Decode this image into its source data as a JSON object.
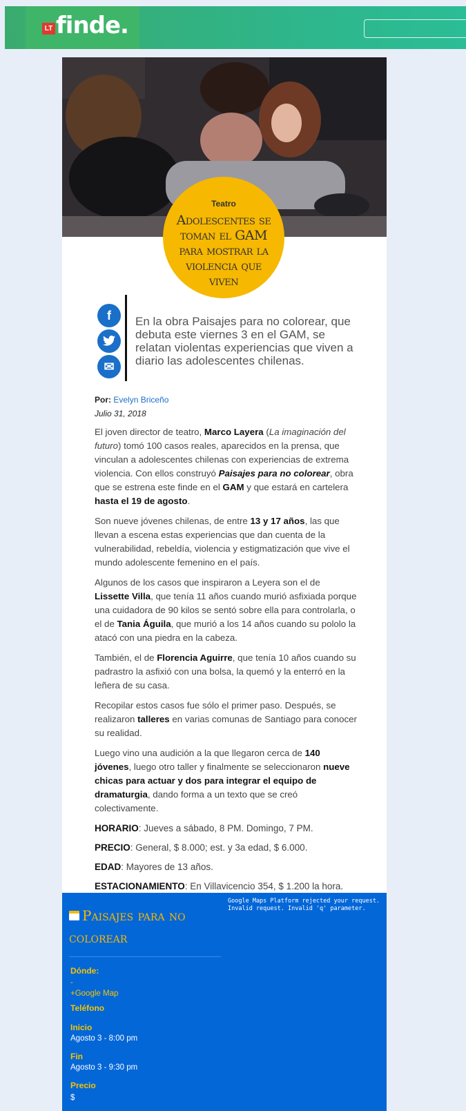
{
  "header": {
    "logo_mark": "LT",
    "logo_text": "finde.",
    "search_placeholder": ""
  },
  "article": {
    "kicker": "Teatro",
    "title": "Adolescentes se toman el GAM para mostrar la violencia que viven",
    "lead": "En la obra Paisajes para no colorear, que debuta este viernes 3 en el GAM, se relatan violentas experiencias que viven a diario las adolescentes chilenas.",
    "byline_label": "Por:",
    "author": "Evelyn Briceño",
    "date": "Julio 31, 2018"
  },
  "share": {
    "facebook": "f",
    "twitter": "t",
    "email": "✉"
  },
  "body": {
    "p1": {
      "a": "El joven director de teatro, ",
      "b": "Marco Layera",
      "c": " (",
      "d": "La imaginación del futuro",
      "e": ") tomó 100 casos reales, aparecidos en la prensa, que vinculan a adolescentes chilenas con experiencias de extrema violencia. Con ellos construyó ",
      "f": "Paisajes para no colorear",
      "g": ", obra que se estrena este finde en el ",
      "h": "GAM",
      "i": " y que estará en cartelera ",
      "j": "hasta el 19 de agosto",
      "k": "."
    },
    "p2": {
      "a": "Son nueve jóvenes chilenas, de entre ",
      "b": "13 y 17 años",
      "c": ", las que llevan a escena estas experiencias que dan cuenta de la vulnerabilidad, rebeldía, violencia y estigmatización que vive el mundo adolescente femenino en el país."
    },
    "p3": {
      "a": "Algunos de los casos que inspiraron a Leyera son el de ",
      "b": "Lissette Villa",
      "c": ", que tenía 11 años cuando murió asfixiada porque una cuidadora de 90 kilos se sentó sobre ella para controlarla, o el de ",
      "d": "Tania Águila",
      "e": ", que murió a los 14 años cuando su pololo la atacó con una piedra en la cabeza."
    },
    "p4": {
      "a": "También, el de ",
      "b": "Florencia Aguirre",
      "c": ", que tenía 10 años cuando su padrastro la asfixió con una bolsa, la quemó y la enterró en la leñera de su casa."
    },
    "p5": {
      "a": "Recopilar estos casos fue sólo el primer paso. Después, se realizaron ",
      "b": "talleres",
      "c": " en varias comunas de Santiago para conocer su realidad."
    },
    "p6": {
      "a": "Luego vino una audición a la que llegaron cerca de ",
      "b": "140 jóvenes",
      "c": ", luego otro taller y finalmente se seleccionaron ",
      "d": "nueve chicas para actuar y dos para integrar el equipo de dramaturgia",
      "e": ", dando forma a un texto que se creó colectivamente."
    },
    "info": [
      {
        "label": "HORARIO",
        "value": ": Jueves a sábado, 8 PM. Domingo, 7 PM."
      },
      {
        "label": "PRECIO",
        "value": ": General, $ 8.000; est. y 3a edad, $ 6.000."
      },
      {
        "label": "EDAD",
        "value": ": Mayores de 13 años."
      },
      {
        "label": "ESTACIONAMIENTO",
        "value": ": En Villavicencio 354, $ 1.200 la hora."
      }
    ]
  },
  "event": {
    "title": "Paisajes para no colorear",
    "map_error": "Google Maps Platform rejected your request. Invalid request. Invalid 'q' parameter.",
    "where_label": "Dónde:",
    "where_value": "-",
    "map_link": "+Google Map",
    "phone_label": "Teléfono",
    "start_label": "Inicio",
    "start_value": "Agosto 3 - 8:00 pm",
    "end_label": "Fin",
    "end_value": "Agosto 3 - 9:30 pm",
    "price_label": "Precio",
    "price_value": "$"
  },
  "colors": {
    "header_green": "#3aab6f",
    "accent_yellow": "#f6b800",
    "event_blue": "#0467d8",
    "link_blue": "#1a6fc8"
  }
}
